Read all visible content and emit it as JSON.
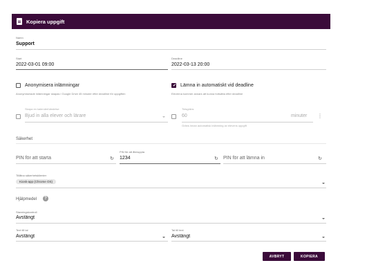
{
  "dialog": {
    "title": "Kopiera uppgift",
    "title_icon": "clipboard-icon"
  },
  "fields": {
    "name": {
      "label": "Namn",
      "value": "Support"
    },
    "start": {
      "label": "Start",
      "value": "2022-03-01 09:00"
    },
    "deadline": {
      "label": "Deadline",
      "value": "2022-03-13 20:00"
    },
    "anonymize": {
      "label": "Anonymisera inlämningar",
      "checked": false,
      "help": "Anonymiserade inlämningar skapas i Google Drive 45 minuter efter deadline för uppgiften"
    },
    "auto_submit": {
      "label": "Lämna in automatiskt vid deadline",
      "checked": true,
      "help": "Eleverna kommer annars att kunna fortsätta efter deadline"
    },
    "invite": {
      "label": "Skapa en kalenderhändelse",
      "value": "Bjud in alla elever och lärare",
      "checked": false
    },
    "time_limit": {
      "label": "Tidsgräns",
      "value": "60",
      "unit": "minuter",
      "help": "Gräns innan automatisk inlämning av elevens uppgift",
      "checked": false
    }
  },
  "security": {
    "heading": "Säkerhet",
    "pin_start": {
      "placeholder": "PIN för att starta"
    },
    "pin_reopen": {
      "label": "PIN för att återuppta",
      "value": "1234"
    },
    "pin_submit": {
      "placeholder": "PIN för att lämna in"
    },
    "clients": {
      "label": "Tillåtna säkerhetsklienter",
      "chip": "Kiosk-app (Chrome OS)"
    }
  },
  "aids": {
    "heading": "Hjälpmedel",
    "spell": {
      "label": "Stavningskontroll",
      "value": "Avstängt"
    },
    "tts": {
      "label": "Text till tal",
      "value": "Avstängt"
    },
    "stt": {
      "label": "Tal till text",
      "value": "Avstängt"
    }
  },
  "buttons": {
    "cancel": "AVBRYT",
    "copy": "KOPIERA"
  },
  "colors": {
    "accent": "#3b0b3a"
  }
}
